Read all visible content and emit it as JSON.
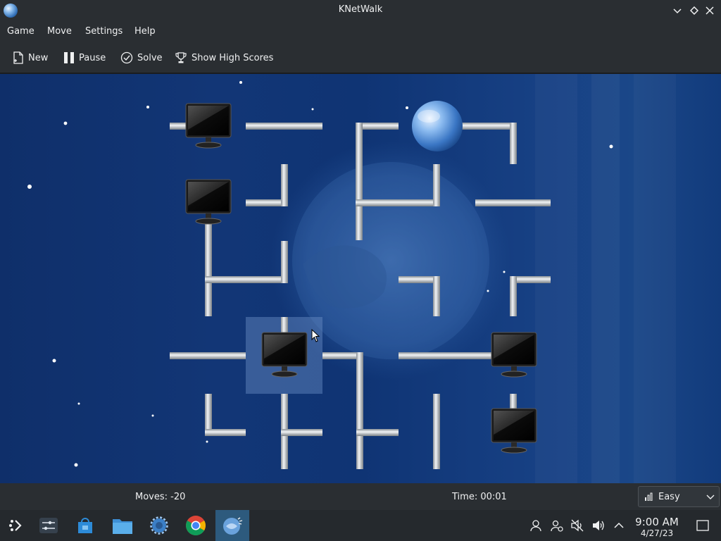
{
  "window": {
    "title": "KNetWalk"
  },
  "menu": {
    "items": [
      "Game",
      "Move",
      "Settings",
      "Help"
    ]
  },
  "toolbar": {
    "new_label": "New",
    "pause_label": "Pause",
    "solve_label": "Solve",
    "high_scores_label": "Show High Scores"
  },
  "status": {
    "moves": "Moves: -20",
    "time": "Time: 00:01",
    "difficulty": "Easy"
  },
  "taskbar": {
    "apps": [
      "application-launcher-icon",
      "settings-sliders-icon",
      "discover-store-icon",
      "file-manager-icon",
      "system-settings-gear-icon",
      "chrome-icon",
      "knetwalk-icon"
    ],
    "clock_time": "9:00 AM",
    "clock_date": "4/27/23"
  },
  "board": {
    "icons": [
      "computer-icon",
      "server-globe-icon",
      "cable-segment"
    ],
    "colors": {
      "background": "#123676",
      "pipe": "#c9cdd1",
      "selected_cell": "#3f6aa8"
    }
  }
}
